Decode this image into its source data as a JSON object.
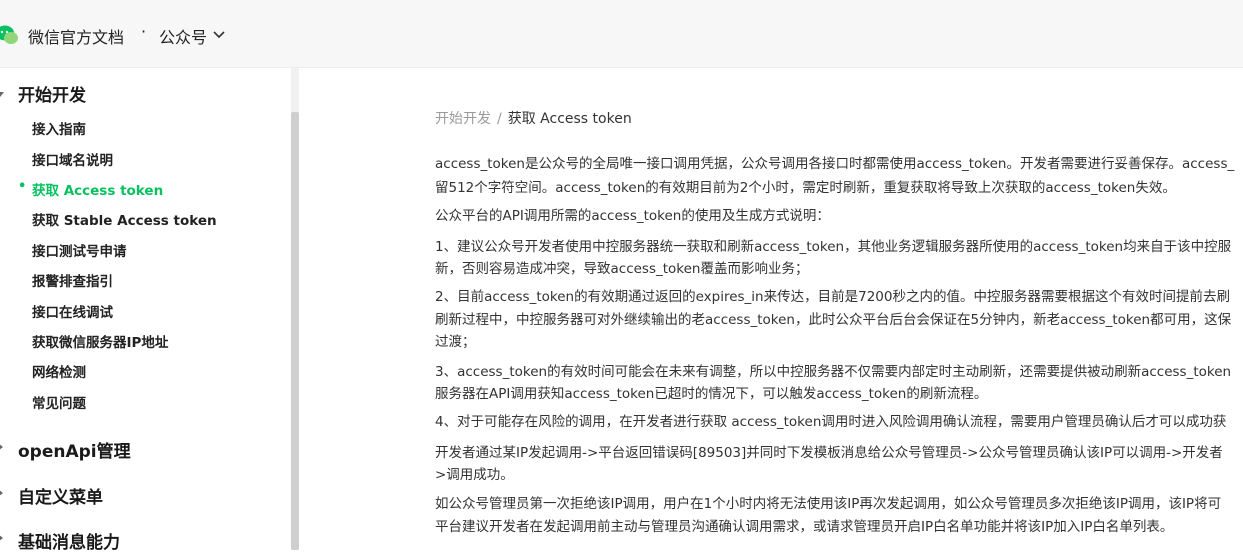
{
  "header": {
    "brand": "微信官方文档",
    "dot": "·",
    "product": "公众号"
  },
  "sidebar": {
    "sections": [
      {
        "label": "开始开发",
        "expanded": true
      },
      {
        "label": "openApi管理",
        "expanded": false
      },
      {
        "label": "自定义菜单",
        "expanded": false
      },
      {
        "label": "基础消息能力",
        "expanded": false
      }
    ],
    "items": [
      {
        "label": "接入指南"
      },
      {
        "label": "接口域名说明"
      },
      {
        "label": "获取 Access token",
        "active": true
      },
      {
        "label": "获取 Stable Access token"
      },
      {
        "label": "接口测试号申请"
      },
      {
        "label": "报警排查指引"
      },
      {
        "label": "接口在线调试"
      },
      {
        "label": "获取微信服务器IP地址"
      },
      {
        "label": "网络检测"
      },
      {
        "label": "常见问题"
      }
    ],
    "bullet": "•"
  },
  "breadcrumb": {
    "parent": "开始开发",
    "separator": "/",
    "current": "获取 Access token"
  },
  "article": {
    "lines": [
      "access_token是公众号的全局唯一接口调用凭据，公众号调用各接口时都需使用access_token。开发者需要进行妥善保存。access_",
      "留512个字符空间。access_token的有效期目前为2个小时，需定时刷新，重复获取将导致上次获取的access_token失效。",
      "公众平台的API调用所需的access_token的使用及生成方式说明：",
      "1、建议公众号开发者使用中控服务器统一获取和刷新access_token，其他业务逻辑服务器所使用的access_token均来自于该中控服",
      "新，否则容易造成冲突，导致access_token覆盖而影响业务；",
      "2、目前access_token的有效期通过返回的expires_in来传达，目前是7200秒之内的值。中控服务器需要根据这个有效时间提前去刷",
      "刷新过程中，中控服务器可对外继续输出的老access_token，此时公众平台后台会保证在5分钟内，新老access_token都可用，这保",
      "过渡；",
      "3、access_token的有效时间可能会在未来有调整，所以中控服务器不仅需要内部定时主动刷新，还需要提供被动刷新access_token",
      "服务器在API调用获知access_token已超时的情况下，可以触发access_token的刷新流程。",
      "4、对于可能存在风险的调用，在开发者进行获取 access_token调用时进入风险调用确认流程，需要用户管理员确认后才可以成功获",
      "开发者通过某IP发起调用->平台返回错误码[89503]并同时下发模板消息给公众号管理员->公众号管理员确认该IP可以调用->开发者",
      ">调用成功。",
      "如公众号管理员第一次拒绝该IP调用，用户在1个小时内将无法使用该IP再次发起调用，如公众号管理员多次拒绝该IP调用，该IP将可",
      "平台建议开发者在发起调用前主动与管理员沟通确认调用需求，或请求管理员开启IP白名单功能并将该IP加入IP白名单列表。"
    ]
  },
  "colors": {
    "accent": "#07c160",
    "topbar": "#f7f7f7"
  }
}
